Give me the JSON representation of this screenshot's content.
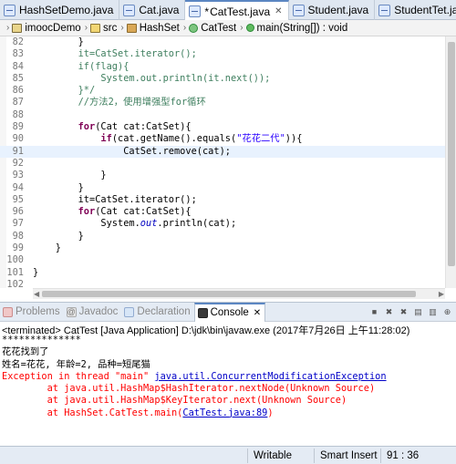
{
  "editor_tabs": [
    {
      "label": "HashSetDemo.java",
      "dirty": false,
      "active": false
    },
    {
      "label": "Cat.java",
      "dirty": false,
      "active": false
    },
    {
      "label": "CatTest.java",
      "dirty": true,
      "active": true
    },
    {
      "label": "Student.java",
      "dirty": false,
      "active": false
    },
    {
      "label": "StudentTet.java",
      "dirty": false,
      "active": false
    }
  ],
  "breadcrumb": [
    "imoocDemo",
    "src",
    "HashSet",
    "CatTest",
    "main(String[]) : void"
  ],
  "code_lines": [
    {
      "num": "82",
      "text": "        }"
    },
    {
      "num": "83",
      "text": "        it=CatSet.iterator();"
    },
    {
      "num": "84",
      "text": "        if(flag){"
    },
    {
      "num": "85",
      "text": "            System.out.println(it.next());"
    },
    {
      "num": "86",
      "text": "        }*/"
    },
    {
      "num": "87",
      "text": "        //方法2，使用增强型for循环"
    },
    {
      "num": "88",
      "text": ""
    },
    {
      "num": "89",
      "text": "        for(Cat cat:CatSet){"
    },
    {
      "num": "90",
      "text": "            if(cat.getName().equals(\"花花二代\")){"
    },
    {
      "num": "91",
      "text": "                CatSet.remove(cat);"
    },
    {
      "num": "92",
      "text": ""
    },
    {
      "num": "93",
      "text": "            }"
    },
    {
      "num": "94",
      "text": "        }"
    },
    {
      "num": "95",
      "text": "        it=CatSet.iterator();"
    },
    {
      "num": "96",
      "text": "        for(Cat cat:CatSet){"
    },
    {
      "num": "97",
      "text": "            System.out.println(cat);"
    },
    {
      "num": "98",
      "text": "        }"
    },
    {
      "num": "99",
      "text": "    }"
    },
    {
      "num": "100",
      "text": ""
    },
    {
      "num": "101",
      "text": "}"
    },
    {
      "num": "102",
      "text": ""
    }
  ],
  "view_tabs": [
    {
      "label": "Problems",
      "icon": "problems-icon",
      "active": false
    },
    {
      "label": "Javadoc",
      "icon": "javadoc-icon",
      "active": false
    },
    {
      "label": "Declaration",
      "icon": "declaration-icon",
      "active": false
    },
    {
      "label": "Console",
      "icon": "console-icon",
      "active": true
    }
  ],
  "console": {
    "terminated": "<terminated> CatTest [Java Application] D:\\jdk\\bin\\javaw.exe (2017年7月26日 上午11:28:02)",
    "output": [
      {
        "type": "normal",
        "text": "**************"
      },
      {
        "type": "normal",
        "text": "花花找到了"
      },
      {
        "type": "normal",
        "text": "姓名=花花, 年龄=2, 品种=短尾猫"
      },
      {
        "type": "exception",
        "prefix": "Exception in thread \"main\" ",
        "link": "java.util.ConcurrentModificationException",
        "suffix": ""
      },
      {
        "type": "stack",
        "prefix": "        at java.util.HashMap$HashIterator.nextNode(Unknown Source)",
        "link": "",
        "suffix": ""
      },
      {
        "type": "stack",
        "prefix": "        at java.util.HashMap$KeyIterator.next(Unknown Source)",
        "link": "",
        "suffix": ""
      },
      {
        "type": "stack",
        "prefix": "        at HashSet.CatTest.main(",
        "link": "CatTest.java:89",
        "suffix": ")"
      }
    ]
  },
  "status": {
    "mode": "Writable",
    "insert": "Smart Insert",
    "position": "91 : 36"
  },
  "colors": {
    "keyword": "#7f0055",
    "string": "#2a00ff",
    "comment": "#3f7f5f",
    "field": "#0000c0",
    "error": "#ff0000",
    "link": "#0000c8",
    "current_line": "#e8f2fe"
  }
}
